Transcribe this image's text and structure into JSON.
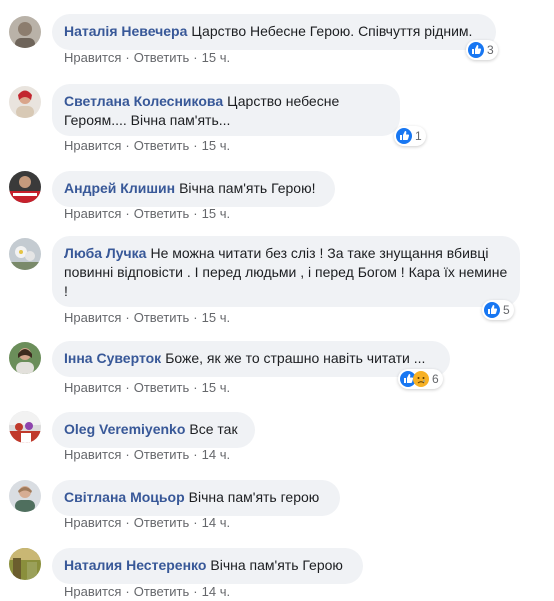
{
  "comments": [
    {
      "author": "Наталія Невечера",
      "text": "Царство Небесне Герою. Співчуття рідним.",
      "like": "Нравится",
      "reply": "Ответить",
      "time": "15 ч.",
      "reactions": "3",
      "reaction_icons": [
        "like-icon"
      ]
    },
    {
      "author": "Светлана Колесникова",
      "text": "Царство небесне Героям.... Вічна пам'ять...",
      "like": "Нравится",
      "reply": "Ответить",
      "time": "15 ч.",
      "reactions": "1",
      "reaction_icons": [
        "like-icon"
      ]
    },
    {
      "author": "Андрей Клишин",
      "text": "Вічна пам'ять Герою!",
      "like": "Нравится",
      "reply": "Ответить",
      "time": "15 ч."
    },
    {
      "author": "Люба Лучка",
      "text": "Не можна читати без сліз ! За таке знущання вбивці повинні відповісти . І перед людьми , і перед Богом ! Кара їх немине !",
      "like": "Нравится",
      "reply": "Ответить",
      "time": "15 ч.",
      "reactions": "5",
      "reaction_icons": [
        "like-icon"
      ]
    },
    {
      "author": "Інна Суверток",
      "text": "Боже, як же то страшно навіть читати ...",
      "like": "Нравится",
      "reply": "Ответить",
      "time": "15 ч.",
      "reactions": "6",
      "reaction_icons": [
        "like-icon",
        "sad-icon"
      ]
    },
    {
      "author": "Oleg Veremiyenko",
      "text": "Все так",
      "like": "Нравится",
      "reply": "Ответить",
      "time": "14 ч."
    },
    {
      "author": "Світлана Моцьор",
      "text": "Вічна пам'ять герою",
      "like": "Нравится",
      "reply": "Ответить",
      "time": "14 ч."
    },
    {
      "author": "Наталия Нестеренко",
      "text": "Вічна пам'ять Герою",
      "like": "Нравится",
      "reply": "Ответить",
      "time": "14 ч."
    }
  ],
  "colors": {
    "author": "#385898",
    "bubble": "#f0f2f5",
    "meta": "#65676b",
    "like": "#1877f2",
    "sad": "#f7b125"
  }
}
